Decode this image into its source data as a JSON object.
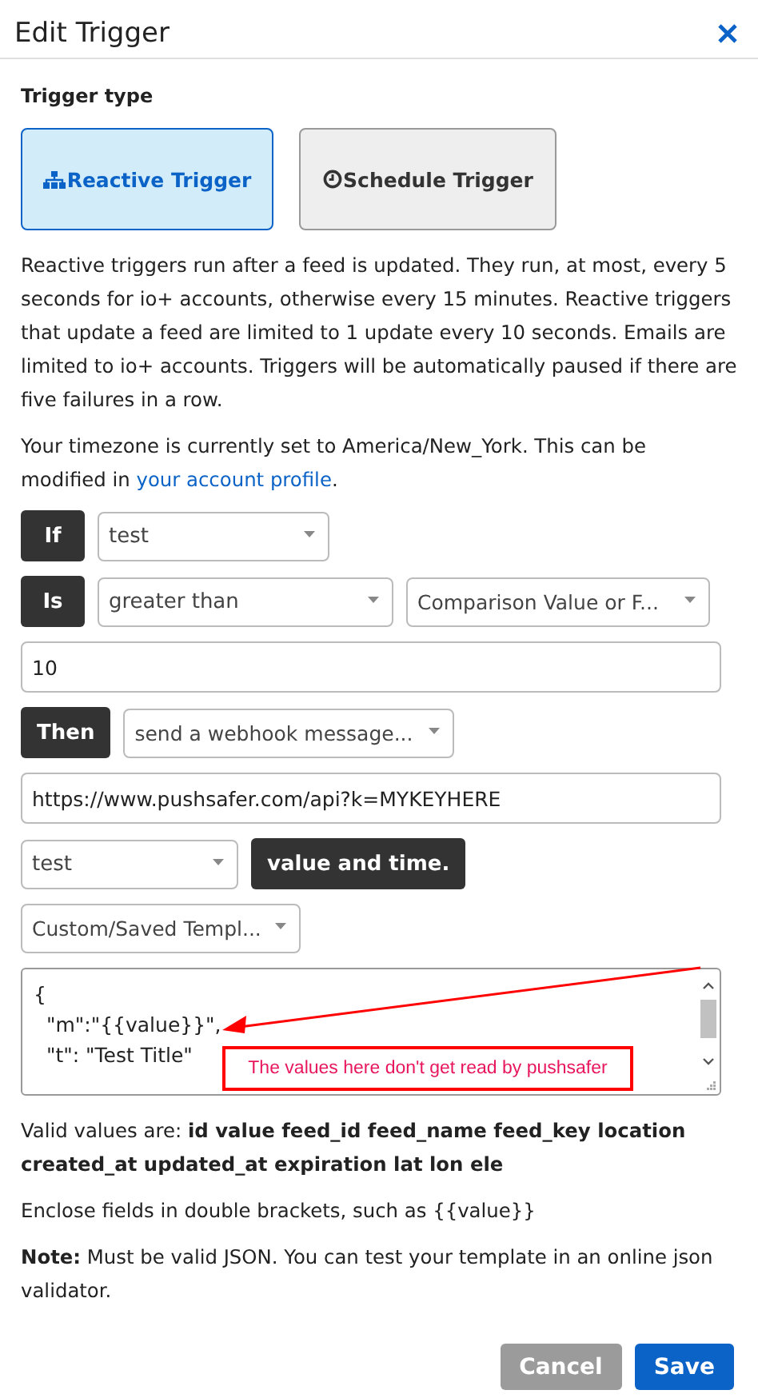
{
  "dialog": {
    "title": "Edit Trigger"
  },
  "trigger_type_label": "Trigger type",
  "trigger_types": [
    {
      "kind": "reactive",
      "label": "Reactive Trigger",
      "selected": true
    },
    {
      "kind": "schedule",
      "label": "Schedule Trigger",
      "selected": false
    }
  ],
  "description": "Reactive triggers run after a feed is updated. They run, at most, every 5 seconds for io+ accounts, otherwise every 15 minutes. Reactive triggers that update a feed are limited to 1 update every 10 seconds. Emails are limited to io+ accounts. Triggers will be automatically paused if there are five failures in a row.",
  "timezone_note": {
    "before": "Your timezone is currently set to America/New_York. This can be modified in ",
    "link": "your account profile",
    "after": "."
  },
  "condition": {
    "if_label": "If",
    "feed": "test",
    "is_label": "Is",
    "operator": "greater than",
    "comparison": "Comparison Value or F...",
    "value": "10"
  },
  "action": {
    "then_label": "Then",
    "action": "send a webhook message...",
    "url": "https://www.pushsafer.com/api?k=MYKEYHERE",
    "feed": "test",
    "payload_label": "value and time.",
    "template": "Custom/Saved Templ...",
    "template_lines": [
      "{",
      "  \"m\":\"{{value}}\",",
      "  \"t\": \"Test Title\""
    ]
  },
  "annotation": "The values here don't get read by pushsafer",
  "valid_values": "Valid values are: **id value feed_id feed_name feed_key location created_at updated_at expiration lat lon ele**",
  "enclose_note": "Enclose fields in double brackets, such as {{value}}",
  "json_note": "**Note:** Must be valid JSON. You can test your template in an online json validator.",
  "buttons": [
    {
      "kind": "cancel",
      "label": "Cancel"
    },
    {
      "kind": "save",
      "label": "Save"
    }
  ]
}
